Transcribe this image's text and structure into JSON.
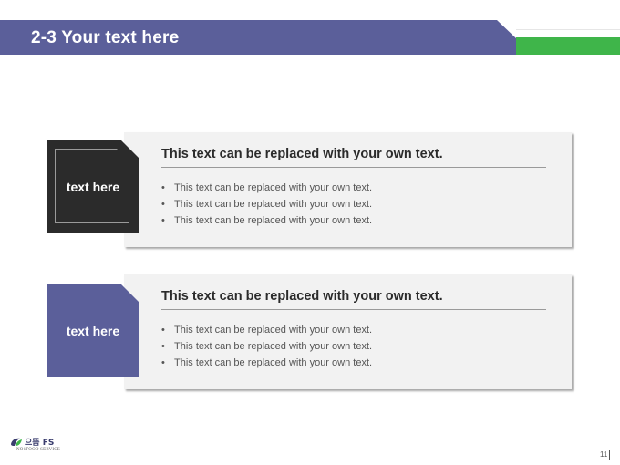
{
  "header": {
    "title": "2-3 Your text here"
  },
  "sections": [
    {
      "tag_label": "text here",
      "heading": "This text can be replaced with your own text.",
      "bullets": [
        "This text can be replaced with your own text.",
        "This text can be replaced with your own text.",
        "This text can be replaced with your own text."
      ]
    },
    {
      "tag_label": "text here",
      "heading": "This text can be replaced with your own text.",
      "bullets": [
        "This text can be replaced with your own text.",
        "This text can be replaced with your own text.",
        "This text can be replaced with your own text."
      ]
    }
  ],
  "footer": {
    "logo_name": "으뜸 FS",
    "logo_sub": "NO1FOOD SERVICE",
    "logo_icon": "brand-logo-icon",
    "page_number": "11"
  },
  "colors": {
    "title_bar": "#5b5f9a",
    "accent_green": "#3fb54a",
    "tag_dark": "#2b2b2b",
    "tag_purple": "#5b5f9a",
    "card_bg": "#f2f2f2"
  }
}
